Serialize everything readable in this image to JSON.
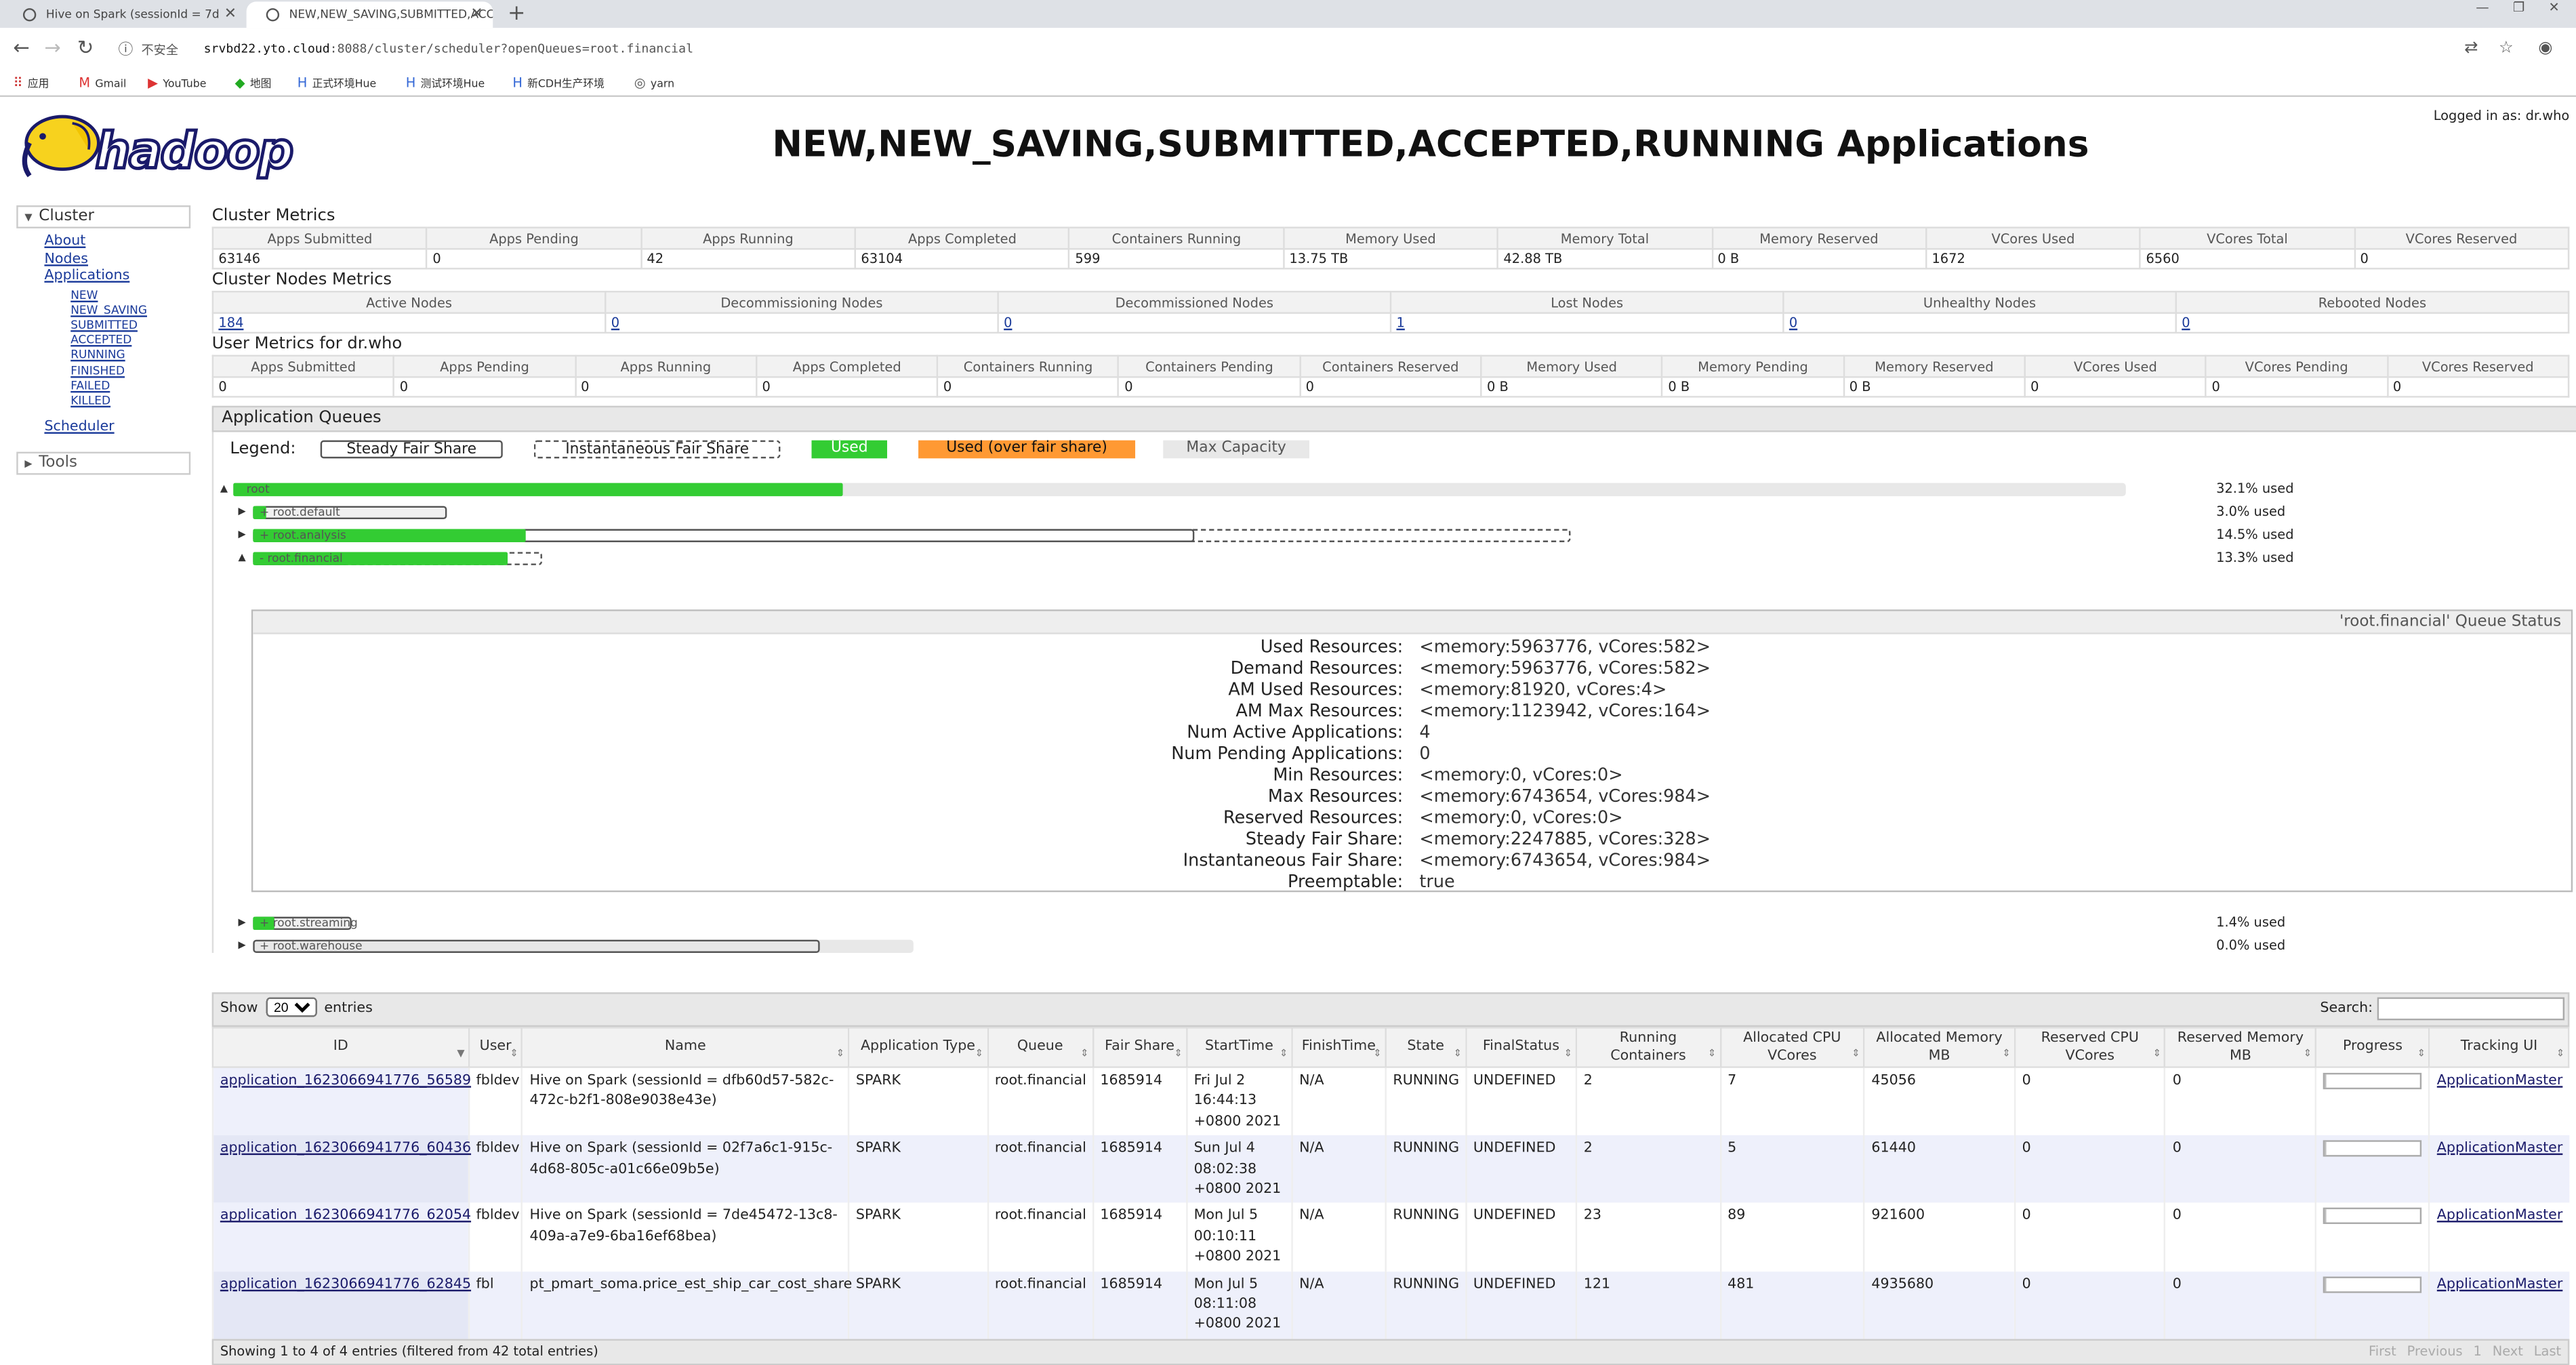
{
  "browser": {
    "tabs": [
      {
        "title": "Hive on Spark (sessionId = 7d"
      },
      {
        "title": "NEW,NEW_SAVING,SUBMITTED,ACC"
      }
    ],
    "new_tab": "+",
    "insecure_label": "不安全",
    "url_host": "srvbd22.yto.cloud",
    "url_rest": ":8088/cluster/scheduler?openQueues=root.financial",
    "bookmarks": [
      "应用",
      "Gmail",
      "YouTube",
      "地图",
      "正式环境Hue",
      "测试环境Hue",
      "新CDH生产环境",
      "yarn"
    ]
  },
  "header": {
    "title": "NEW,NEW_SAVING,SUBMITTED,ACCEPTED,RUNNING Applications",
    "logged_in": "Logged in as: dr.who",
    "logo_text": "hadoop"
  },
  "sidebar": {
    "cluster_label": "Cluster",
    "links": [
      "About",
      "Nodes",
      "Applications"
    ],
    "app_states": [
      "NEW",
      "NEW_SAVING",
      "SUBMITTED",
      "ACCEPTED",
      "RUNNING",
      "FINISHED",
      "FAILED",
      "KILLED"
    ],
    "scheduler": "Scheduler",
    "tools_label": "Tools"
  },
  "cluster_metrics": {
    "title": "Cluster Metrics",
    "headers": [
      "Apps Submitted",
      "Apps Pending",
      "Apps Running",
      "Apps Completed",
      "Containers Running",
      "Memory Used",
      "Memory Total",
      "Memory Reserved",
      "VCores Used",
      "VCores Total",
      "VCores Reserved"
    ],
    "values": [
      "63146",
      "0",
      "42",
      "63104",
      "599",
      "13.75 TB",
      "42.88 TB",
      "0 B",
      "1672",
      "6560",
      "0"
    ]
  },
  "node_metrics": {
    "title": "Cluster Nodes Metrics",
    "headers": [
      "Active Nodes",
      "Decommissioning Nodes",
      "Decommissioned Nodes",
      "Lost Nodes",
      "Unhealthy Nodes",
      "Rebooted Nodes"
    ],
    "values": [
      "184",
      "0",
      "0",
      "1",
      "0",
      "0"
    ]
  },
  "user_metrics": {
    "title": "User Metrics for dr.who",
    "headers": [
      "Apps Submitted",
      "Apps Pending",
      "Apps Running",
      "Apps Completed",
      "Containers Running",
      "Containers Pending",
      "Containers Reserved",
      "Memory Used",
      "Memory Pending",
      "Memory Reserved",
      "VCores Used",
      "VCores Pending",
      "VCores Reserved"
    ],
    "values": [
      "0",
      "0",
      "0",
      "0",
      "0",
      "0",
      "0",
      "0 B",
      "0 B",
      "0 B",
      "0",
      "0",
      "0"
    ]
  },
  "queues": {
    "title": "Application Queues",
    "legend_label": "Legend:",
    "legend": [
      "Steady Fair Share",
      "Instantaneous Fair Share",
      "Used",
      "Used (over fair share)",
      "Max Capacity"
    ],
    "legend_colors": {
      "used": "#33cc33",
      "over": "#ff9933",
      "max": "#e8e8e8"
    },
    "rows": [
      {
        "name": "root",
        "used_pct": "32.1% used",
        "used_fraction": 0.321
      },
      {
        "name": "root.default",
        "used_pct": "3.0% used",
        "used_fraction": 0.03
      },
      {
        "name": "root.analysis",
        "used_pct": "14.5% used",
        "used_fraction": 0.145
      },
      {
        "name": "root.financial",
        "used_pct": "13.3% used",
        "used_fraction": 0.133
      },
      {
        "name": "root.streaming",
        "used_pct": "1.4% used",
        "used_fraction": 0.014
      },
      {
        "name": "root.warehouse",
        "used_pct": "0.0% used",
        "used_fraction": 0.0
      }
    ],
    "status": {
      "title": "'root.financial' Queue Status",
      "fields": [
        {
          "k": "Used Resources:",
          "v": "<memory:5963776, vCores:582>"
        },
        {
          "k": "Demand Resources:",
          "v": "<memory:5963776, vCores:582>"
        },
        {
          "k": "AM Used Resources:",
          "v": "<memory:81920, vCores:4>"
        },
        {
          "k": "AM Max Resources:",
          "v": "<memory:1123942, vCores:164>"
        },
        {
          "k": "Num Active Applications:",
          "v": "4"
        },
        {
          "k": "Num Pending Applications:",
          "v": "0"
        },
        {
          "k": "Min Resources:",
          "v": "<memory:0, vCores:0>"
        },
        {
          "k": "Max Resources:",
          "v": "<memory:6743654, vCores:984>"
        },
        {
          "k": "Reserved Resources:",
          "v": "<memory:0, vCores:0>"
        },
        {
          "k": "Steady Fair Share:",
          "v": "<memory:2247885, vCores:328>"
        },
        {
          "k": "Instantaneous Fair Share:",
          "v": "<memory:6743654, vCores:984>"
        },
        {
          "k": "Preemptable:",
          "v": "true"
        }
      ]
    }
  },
  "apps": {
    "show_label": "Show",
    "entries_value": "20",
    "entries_label": "entries",
    "search_label": "Search:",
    "headers": [
      "ID",
      "User",
      "Name",
      "Application Type",
      "Queue",
      "Fair Share",
      "StartTime",
      "FinishTime",
      "State",
      "FinalStatus",
      "Running Containers",
      "Allocated CPU VCores",
      "Allocated Memory MB",
      "Reserved CPU VCores",
      "Reserved Memory MB",
      "Progress",
      "Tracking UI"
    ],
    "rows": [
      {
        "id": "application_1623066941776_56589",
        "user": "fbldev",
        "name": "Hive on Spark (sessionId = dfb60d57-582c-472c-b2f1-808e9038e43e)",
        "type": "SPARK",
        "queue": "root.financial",
        "fair": "1685914",
        "start": "Fri Jul 2 16:44:13 +0800 2021",
        "finish": "N/A",
        "state": "RUNNING",
        "final": "UNDEFINED",
        "containers": "2",
        "cpu": "7",
        "mem": "45056",
        "rcpu": "0",
        "rmem": "0",
        "progress": 0.1,
        "tracking": "ApplicationMaster"
      },
      {
        "id": "application_1623066941776_60436",
        "user": "fbldev",
        "name": "Hive on Spark (sessionId = 02f7a6c1-915c-4d68-805c-a01c66e09b5e)",
        "type": "SPARK",
        "queue": "root.financial",
        "fair": "1685914",
        "start": "Sun Jul 4 08:02:38 +0800 2021",
        "finish": "N/A",
        "state": "RUNNING",
        "final": "UNDEFINED",
        "containers": "2",
        "cpu": "5",
        "mem": "61440",
        "rcpu": "0",
        "rmem": "0",
        "progress": 0.1,
        "tracking": "ApplicationMaster"
      },
      {
        "id": "application_1623066941776_62054",
        "user": "fbldev",
        "name": "Hive on Spark (sessionId = 7de45472-13c8-409a-a7e9-6ba16ef68bea)",
        "type": "SPARK",
        "queue": "root.financial",
        "fair": "1685914",
        "start": "Mon Jul 5 00:10:11 +0800 2021",
        "finish": "N/A",
        "state": "RUNNING",
        "final": "UNDEFINED",
        "containers": "23",
        "cpu": "89",
        "mem": "921600",
        "rcpu": "0",
        "rmem": "0",
        "progress": 0.1,
        "tracking": "ApplicationMaster"
      },
      {
        "id": "application_1623066941776_62845",
        "user": "fbl",
        "name": "pt_pmart_soma.price_est_ship_car_cost_share",
        "type": "SPARK",
        "queue": "root.financial",
        "fair": "1685914",
        "start": "Mon Jul 5 08:11:08 +0800 2021",
        "finish": "N/A",
        "state": "RUNNING",
        "final": "UNDEFINED",
        "containers": "121",
        "cpu": "481",
        "mem": "4935680",
        "rcpu": "0",
        "rmem": "0",
        "progress": 0.1,
        "tracking": "ApplicationMaster"
      }
    ],
    "footer": "Showing 1 to 4 of 4 entries (filtered from 42 total entries)",
    "pager": [
      "First",
      "Previous",
      "1",
      "Next",
      "Last"
    ]
  }
}
